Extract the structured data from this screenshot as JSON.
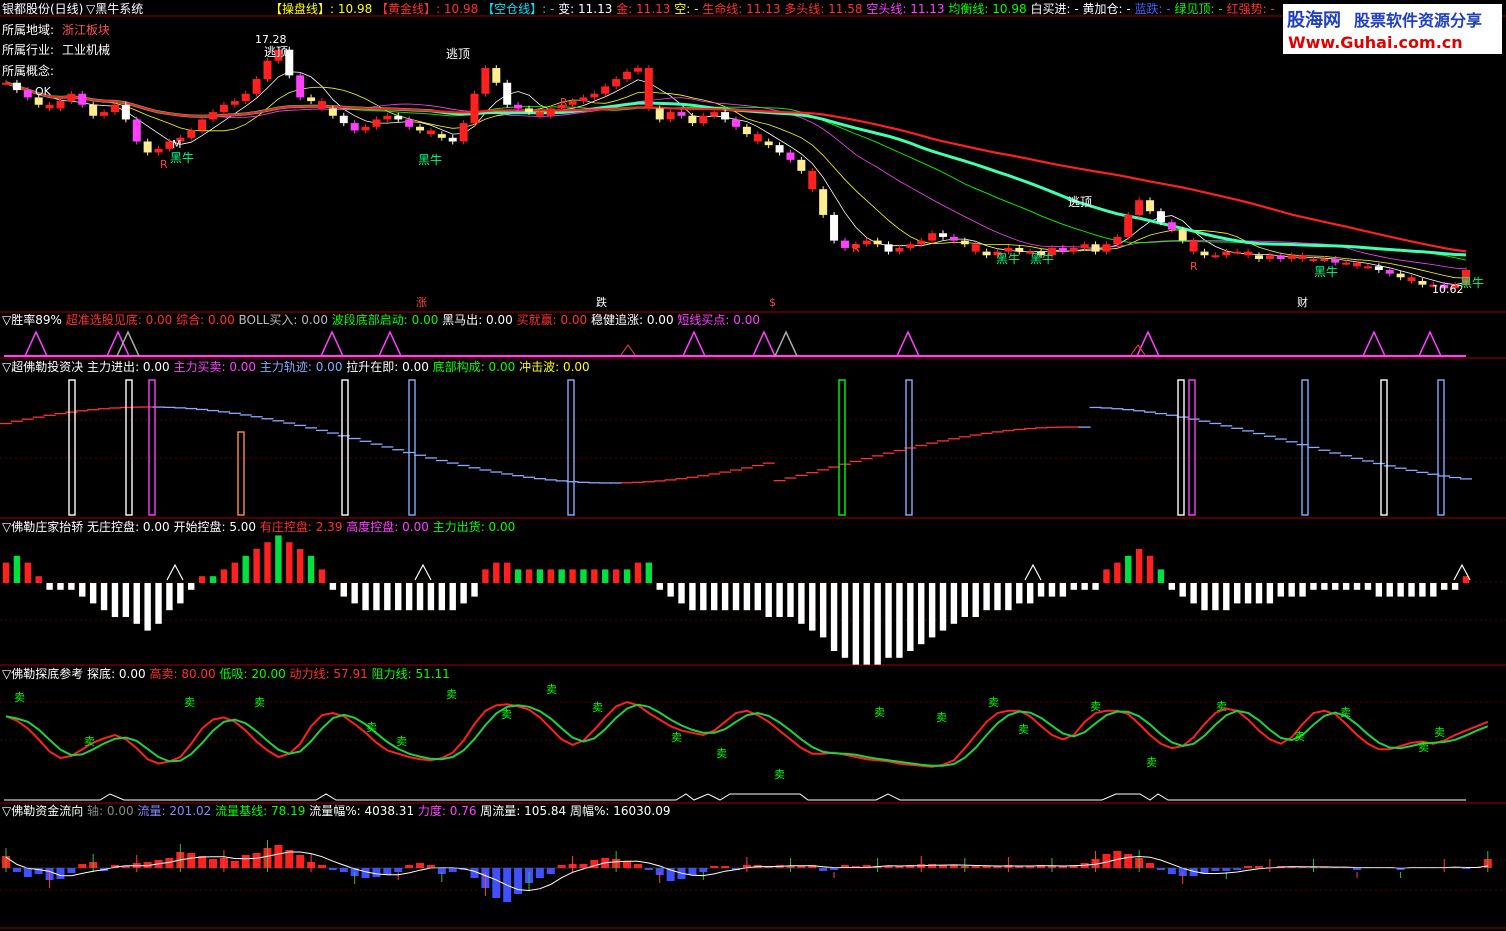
{
  "header": {
    "stock": "银都股份(日线)",
    "system": "▽黑牛系统",
    "items": [
      {
        "label": "【操盘线】",
        "value": ": 10.98",
        "color": "#ffff00"
      },
      {
        "label": "【黄金线】",
        "value": ": 10.98",
        "color": "#ff3030"
      },
      {
        "label": "【空仓线】",
        "value": ": -",
        "color": "#00e0ff"
      },
      {
        "label": "变",
        "value": ": 11.13",
        "color": "#ffffff"
      },
      {
        "label": "金",
        "value": ": 11.13",
        "color": "#ff3030"
      },
      {
        "label": "空",
        "value": ": -",
        "color": "#ffff00"
      },
      {
        "label": "生命线",
        "value": ": 11.13",
        "color": "#ff3030"
      },
      {
        "label": "多头线",
        "value": ": 11.58",
        "color": "#ff3030"
      },
      {
        "label": "空头线",
        "value": ": 11.13",
        "color": "#ff40ff"
      },
      {
        "label": "均衡线",
        "value": ": 10.98",
        "color": "#00ff00"
      },
      {
        "label": "白买进",
        "value": ": -",
        "color": "#ffffff"
      },
      {
        "label": "黄加仓",
        "value": ": -",
        "color": "#ffffff"
      },
      {
        "label": "蓝跌",
        "value": ": -",
        "color": "#4060ff"
      },
      {
        "label": "绿见顶",
        "value": ": -",
        "color": "#00ff00"
      },
      {
        "label": "红强势",
        "value": ": -",
        "color": "#ff3030"
      }
    ]
  },
  "watermark": {
    "title": "股海网",
    "subtitle": "股票软件资源分享",
    "url": "Www.Guhai.com.cn"
  },
  "info": {
    "region_label": "所属地域:",
    "region_value": "浙江板块",
    "industry_label": "所属行业:",
    "industry_value": "工业机械",
    "concept_label": "所属概念:"
  },
  "annotations": {
    "high_label": "17.28",
    "low_label": "10.62",
    "escape_top": "逃顶",
    "black_bull": "黑牛",
    "ok": "OK",
    "r": "R",
    "m": "M",
    "zhang": "涨",
    "die": "跌",
    "dollar": "$",
    "cai": "财"
  },
  "panels": {
    "p1": {
      "title": "▽胜率89%",
      "items": [
        {
          "label": "超准选股见底",
          "value": ": 0.00",
          "color": "#ff3030"
        },
        {
          "label": "综合",
          "value": ": 0.00",
          "color": "#ff3030"
        },
        {
          "label": "BOLL买入",
          "value": ": 0.00",
          "color": "#bbbbbb"
        },
        {
          "label": "波段底部启动",
          "value": ": 0.00",
          "color": "#00ff00"
        },
        {
          "label": "黑马出",
          "value": ": 0.00",
          "color": "#ffffff"
        },
        {
          "label": "买就赢",
          "value": ": 0.00",
          "color": "#ff3030"
        },
        {
          "label": "稳健追涨",
          "value": ": 0.00",
          "color": "#ffffff"
        },
        {
          "label": "短线买点",
          "value": ": 0.00",
          "color": "#ff40ff"
        }
      ]
    },
    "p2": {
      "title": "▽超佛勒投资决",
      "items": [
        {
          "label": "主力进出",
          "value": ": 0.00",
          "color": "#ffffff"
        },
        {
          "label": "主力买卖",
          "value": ": 0.00",
          "color": "#ff40ff"
        },
        {
          "label": "主力轨迹",
          "value": ": 0.00",
          "color": "#88aaff"
        },
        {
          "label": "拉升在即",
          "value": ": 0.00",
          "color": "#ffffff"
        },
        {
          "label": "底部构成",
          "value": ": 0.00",
          "color": "#00ff00"
        },
        {
          "label": "冲击波",
          "value": ": 0.00",
          "color": "#ffff00"
        }
      ]
    },
    "p3": {
      "title": "▽佛勒庄家抬轿",
      "items": [
        {
          "label": "无庄控盘",
          "value": ": 0.00",
          "color": "#ffffff"
        },
        {
          "label": "开始控盘",
          "value": ": 5.00",
          "color": "#ffffff"
        },
        {
          "label": "有庄控盘",
          "value": ": 2.39",
          "color": "#ff3030"
        },
        {
          "label": "高度控盘",
          "value": ": 0.00",
          "color": "#ff40ff"
        },
        {
          "label": "主力出货",
          "value": ": 0.00",
          "color": "#00ff00"
        }
      ]
    },
    "p4": {
      "title": "▽佛勒探底参考",
      "items": [
        {
          "label": "探底",
          "value": ": 0.00",
          "color": "#ffffff"
        },
        {
          "label": "高卖",
          "value": ": 80.00",
          "color": "#ff3030"
        },
        {
          "label": "低吸",
          "value": ": 20.00",
          "color": "#00ff00"
        },
        {
          "label": "动力线",
          "value": ": 57.91",
          "color": "#ff3030"
        },
        {
          "label": "阻力线",
          "value": ": 51.11",
          "color": "#00ff00"
        }
      ],
      "sell_label": "卖"
    },
    "p5": {
      "title": "▽佛勒资金流向",
      "items": [
        {
          "label": "轴",
          "value": ": 0.00",
          "color": "#888888"
        },
        {
          "label": "流量",
          "value": ": 201.02",
          "color": "#8888ff"
        },
        {
          "label": "流量基线",
          "value": ": 78.19",
          "color": "#00ff00"
        },
        {
          "label": "流量幅%",
          "value": ": 4038.31",
          "color": "#ffffff"
        },
        {
          "label": "力度",
          "value": ": 0.76",
          "color": "#ff40ff"
        },
        {
          "label": "周流量",
          "value": ": 105.84",
          "color": "#ffffff"
        },
        {
          "label": "周幅%",
          "value": ": 16030.09",
          "color": "#ffffff"
        }
      ]
    }
  },
  "chart_data": [
    {
      "type": "candlestick",
      "name": "main",
      "close": [
        16.2,
        16.0,
        15.8,
        15.6,
        15.5,
        15.7,
        15.9,
        15.6,
        15.3,
        15.4,
        15.6,
        15.2,
        14.6,
        14.3,
        14.4,
        14.6,
        14.7,
        14.9,
        15.2,
        15.4,
        15.6,
        15.7,
        15.9,
        16.3,
        16.8,
        17.1,
        16.4,
        15.8,
        15.7,
        15.5,
        15.3,
        15.1,
        14.9,
        15.0,
        15.2,
        15.3,
        15.2,
        15.0,
        14.9,
        14.8,
        14.7,
        14.6,
        15.1,
        15.9,
        16.6,
        16.2,
        15.6,
        15.5,
        15.4,
        15.3,
        15.5,
        15.6,
        15.7,
        15.8,
        15.9,
        16.1,
        16.3,
        16.5,
        16.6,
        15.5,
        15.2,
        15.4,
        15.3,
        15.1,
        15.3,
        15.4,
        15.2,
        15.0,
        14.8,
        14.6,
        14.5,
        14.3,
        14.1,
        13.8,
        13.3,
        12.6,
        11.9,
        11.7,
        11.8,
        11.9,
        11.8,
        11.6,
        11.7,
        11.8,
        11.9,
        12.1,
        12.0,
        11.9,
        11.8,
        11.6,
        11.5,
        11.6,
        11.7,
        11.6,
        11.6,
        11.5,
        11.7,
        11.6,
        11.7,
        11.8,
        11.6,
        11.8,
        12.0,
        12.6,
        13.0,
        12.7,
        12.4,
        12.2,
        11.9,
        11.6,
        11.5,
        11.5,
        11.6,
        11.6,
        11.5,
        11.4,
        11.5,
        11.4,
        11.5,
        11.4,
        11.4,
        11.4,
        11.3,
        11.3,
        11.2,
        11.2,
        11.1,
        11.0,
        10.9,
        10.8,
        10.7,
        10.7,
        10.6,
        10.7,
        11.1
      ]
    },
    {
      "type": "line",
      "name": "p4",
      "red": [
        67,
        63,
        56,
        46,
        35,
        29,
        31,
        37,
        43,
        47,
        50,
        46,
        38,
        28,
        24,
        26,
        30,
        42,
        56,
        64,
        66,
        62,
        54,
        44,
        36,
        30,
        33,
        42,
        58,
        68,
        70,
        67,
        60,
        52,
        43,
        36,
        33,
        30,
        28,
        27,
        29,
        34,
        45,
        60,
        72,
        77,
        78,
        76,
        73,
        66,
        56,
        46,
        41,
        45,
        55,
        66,
        76,
        80,
        77,
        70,
        64,
        58,
        54,
        52,
        50,
        54,
        62,
        70,
        72,
        68,
        62,
        54,
        46,
        38,
        33,
        33,
        34,
        32,
        30,
        28,
        27,
        26,
        24,
        23,
        22,
        21,
        23,
        27,
        38,
        50,
        62,
        70,
        72,
        72,
        67,
        58,
        50,
        46,
        50,
        62,
        70,
        72,
        72,
        69,
        60,
        50,
        42,
        38,
        40,
        48,
        60,
        70,
        74,
        72,
        64,
        54,
        46,
        42,
        48,
        60,
        70,
        72,
        69,
        60,
        50,
        42,
        37,
        37,
        40,
        43,
        44,
        42,
        45,
        50,
        54,
        58,
        62
      ]
    },
    {
      "type": "bar",
      "name": "p3",
      "values": [
        3,
        4,
        3,
        1,
        -1,
        -1,
        -1,
        -2,
        -3,
        -4,
        -5,
        -5,
        -6,
        -7,
        -6,
        -4,
        -3,
        -1,
        1,
        1,
        2,
        3,
        4,
        5,
        6,
        7,
        6,
        5,
        4,
        2,
        -1,
        -2,
        -3,
        -4,
        -4,
        -4,
        -4,
        -4,
        -4,
        -4,
        -4,
        -4,
        -3,
        -2,
        2,
        3,
        3,
        2,
        2,
        2,
        2,
        2,
        2,
        2,
        2,
        2,
        2,
        2,
        3,
        3,
        -1,
        -2,
        -3,
        -4,
        -4,
        -4,
        -4,
        -4,
        -4,
        -4,
        -5,
        -5,
        -5,
        -6,
        -7,
        -8,
        -10,
        -11,
        -12,
        -12,
        -12,
        -11,
        -11,
        -10,
        -9,
        -8,
        -7,
        -6,
        -5,
        -5,
        -4,
        -4,
        -4,
        -3,
        -3,
        -2,
        -2,
        -2,
        -1,
        -1,
        -1,
        2,
        3,
        4,
        5,
        4,
        2,
        -1,
        -2,
        -3,
        -4,
        -4,
        -4,
        -3,
        -3,
        -3,
        -3,
        -2,
        -2,
        -2,
        -1,
        -1,
        -1,
        -1,
        -1,
        -1,
        -2,
        -2,
        -2,
        -2,
        -2,
        -2,
        -1,
        -1,
        1
      ]
    },
    {
      "type": "bar",
      "name": "p5",
      "values": [
        1.2,
        -0.4,
        -0.9,
        -0.6,
        -1.2,
        -1.1,
        -0.5,
        0.4,
        0.6,
        -0.3,
        0.3,
        0.2,
        0.5,
        0.6,
        0.8,
        1.0,
        1.6,
        1.5,
        1.2,
        0.9,
        1.0,
        0.7,
        1.3,
        1.5,
        2.0,
        2.3,
        1.8,
        1.3,
        0.6,
        0.3,
        -0.2,
        -0.4,
        -0.8,
        -1.0,
        -0.9,
        -0.7,
        -0.4,
        0.3,
        0.5,
        0.3,
        -0.6,
        -0.4,
        -0.2,
        -1.0,
        -2.0,
        -3.0,
        -3.4,
        -2.6,
        -1.5,
        -1.0,
        -0.6,
        0.3,
        0.4,
        0.4,
        0.8,
        1.0,
        0.9,
        0.7,
        0.4,
        -0.2,
        -0.7,
        -1.3,
        -1.1,
        -0.7,
        -0.4,
        0.2,
        0.2,
        -0.2,
        0.3,
        0.3,
        0.2,
        0.3,
        0.2,
        0.2,
        0.3,
        -0.3,
        -0.2,
        0.3,
        0.2,
        0.3,
        0.2,
        0.2,
        0.2,
        0.3,
        0.4,
        0.4,
        0.3,
        0.3,
        0.2,
        0.2,
        0.2,
        0.2,
        0.3,
        0.2,
        0.2,
        0.3,
        0.2,
        0.2,
        0.3,
        0.5,
        0.9,
        1.4,
        1.7,
        1.4,
        1.0,
        0.5,
        -0.2,
        -0.6,
        -0.8,
        -0.8,
        -0.6,
        -0.3,
        -0.3,
        -0.2,
        0.2,
        0.2,
        0.1,
        0.2,
        0.1,
        0.1,
        0.1,
        0.1,
        0.1,
        0.1,
        -0.2,
        0.1,
        0.1,
        0.1,
        -0.2,
        0.1,
        0.1,
        0.1,
        0.1,
        0.1,
        -0.1,
        0.1,
        0.9
      ]
    }
  ]
}
